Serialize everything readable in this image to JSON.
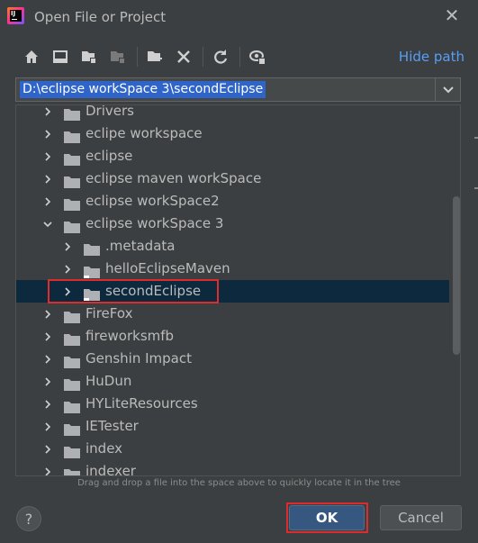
{
  "window": {
    "title": "Open File or Project",
    "app_icon": "intellij-idea-icon",
    "close_icon": "close-icon"
  },
  "toolbar": {
    "buttons": [
      {
        "name": "home-icon"
      },
      {
        "name": "desktop-icon"
      },
      {
        "name": "project-folder-icon"
      },
      {
        "name": "module-folder-icon"
      },
      {
        "name": "new-folder-icon"
      },
      {
        "name": "delete-icon"
      },
      {
        "name": "refresh-icon"
      },
      {
        "name": "show-hidden-icon"
      }
    ],
    "hide_path_label": "Hide path"
  },
  "path": {
    "value": "D:\\eclipse workSpace 3\\secondEclipse"
  },
  "tree": {
    "items": [
      {
        "label": "Drivers",
        "expanded": false,
        "level": 0
      },
      {
        "label": "eclipe workspace",
        "expanded": false,
        "level": 0
      },
      {
        "label": "eclipse",
        "expanded": false,
        "level": 0
      },
      {
        "label": "eclipse maven workSpace",
        "expanded": false,
        "level": 0
      },
      {
        "label": "eclipse workSpace2",
        "expanded": false,
        "level": 0
      },
      {
        "label": "eclipse workSpace 3",
        "expanded": true,
        "level": 0
      },
      {
        "label": ".metadata",
        "expanded": false,
        "level": 1
      },
      {
        "label": "helloEclipseMaven",
        "expanded": false,
        "level": 1,
        "project": true
      },
      {
        "label": "secondEclipse",
        "expanded": false,
        "level": 1,
        "project": true,
        "selected": true
      },
      {
        "label": "FireFox",
        "expanded": false,
        "level": 0
      },
      {
        "label": "fireworksmfb",
        "expanded": false,
        "level": 0
      },
      {
        "label": "Genshin Impact",
        "expanded": false,
        "level": 0
      },
      {
        "label": "HuDun",
        "expanded": false,
        "level": 0
      },
      {
        "label": "HYLiteResources",
        "expanded": false,
        "level": 0
      },
      {
        "label": "IETester",
        "expanded": false,
        "level": 0
      },
      {
        "label": "index",
        "expanded": false,
        "level": 0
      },
      {
        "label": "indexer",
        "expanded": false,
        "level": 0
      }
    ]
  },
  "hint": "Drag and drop a file into the space above to quickly locate it in the tree",
  "footer": {
    "help_label": "?",
    "ok_label": "OK",
    "cancel_label": "Cancel"
  },
  "colors": {
    "background": "#3c3f41",
    "link": "#589df6",
    "selection": "#0d293e",
    "highlight_box": "#e02b2b",
    "ok_button": "#365880"
  }
}
